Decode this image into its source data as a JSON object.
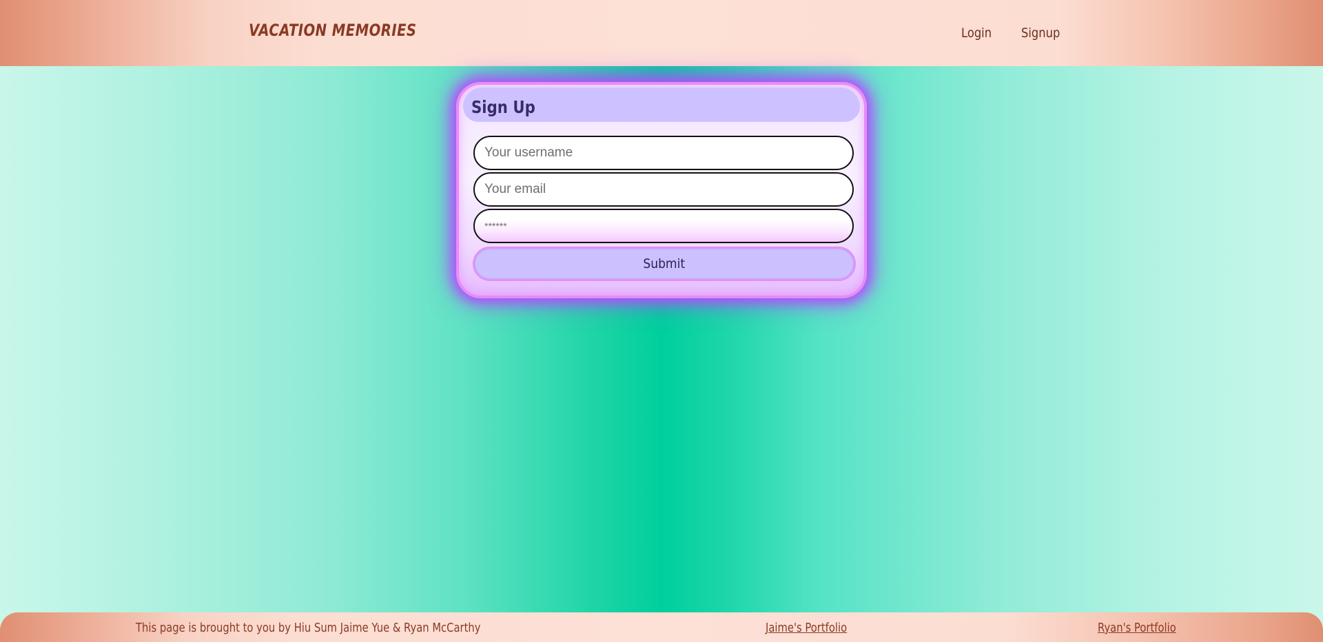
{
  "header": {
    "brand": "VACATION MEMORIES",
    "nav": {
      "login": "Login",
      "signup": "Signup"
    }
  },
  "signup_card": {
    "title": "Sign Up",
    "username_placeholder": "Your username",
    "email_placeholder": "Your email",
    "password_placeholder": "******",
    "submit_label": "Submit"
  },
  "footer": {
    "credit": "This page is brought to you by Hiu Sum Jaime Yue & Ryan McCarthy",
    "jaime_link": "Jaime's Portfolio",
    "ryan_link": "Ryan's Portfolio"
  },
  "colors": {
    "accent_background": "#00cf9d",
    "header_background": "#fde0d6",
    "card_glow": "#b04dff",
    "button_background": "#ccc0ff",
    "text_brown": "#8a3a24"
  }
}
